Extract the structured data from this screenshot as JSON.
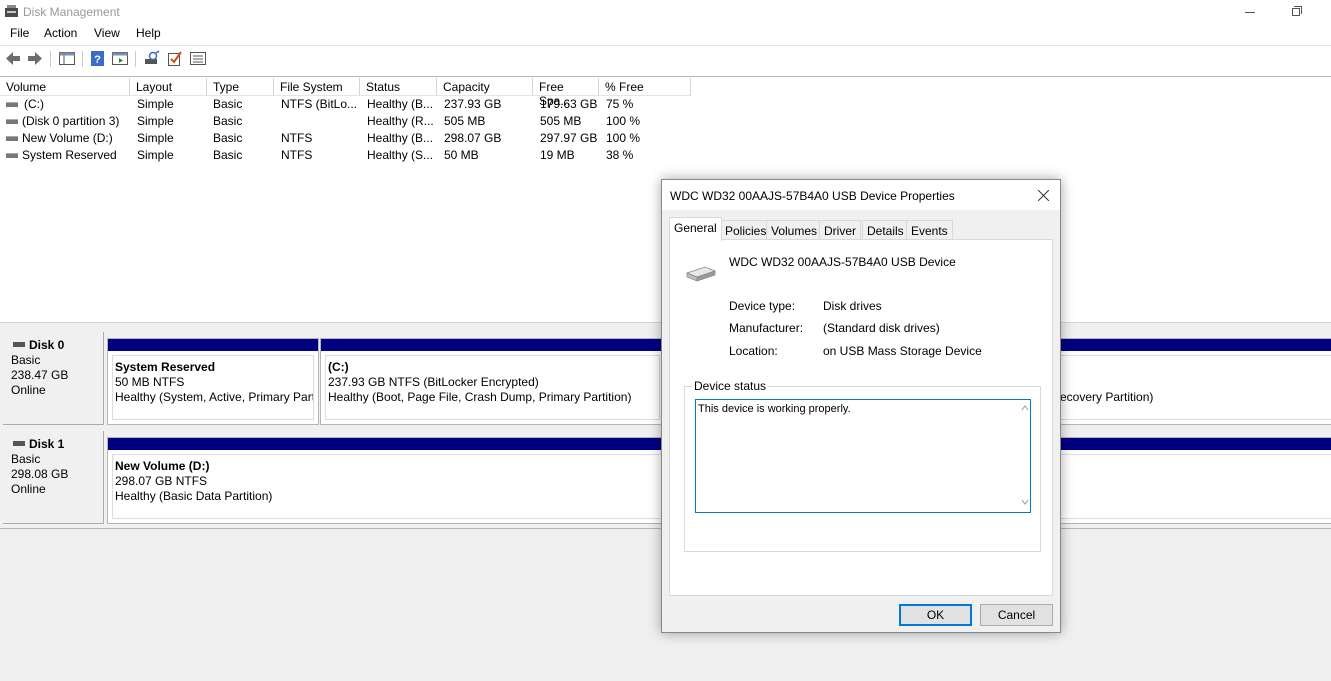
{
  "window": {
    "title": "Disk Management",
    "icon": "disk-management-icon"
  },
  "menu": [
    "File",
    "Action",
    "View",
    "Help"
  ],
  "toolbar": {
    "icons": [
      "back-arrow-icon",
      "forward-arrow-icon",
      "console-tree-icon",
      "help-icon",
      "properties-icon",
      "rescan-icon",
      "checklist-icon",
      "list-view-icon"
    ]
  },
  "volume_list": {
    "columns": [
      "Volume",
      "Layout",
      "Type",
      "File System",
      "Status",
      "Capacity",
      "Free Spa...",
      "% Free"
    ],
    "rows": [
      {
        "volume": "(C:)",
        "layout": "Simple",
        "type": "Basic",
        "fs": "NTFS (BitLo...",
        "status": "Healthy (B...",
        "capacity": "237.93 GB",
        "free": "179.63 GB",
        "pct": "75 %"
      },
      {
        "volume": "(Disk 0 partition 3)",
        "layout": "Simple",
        "type": "Basic",
        "fs": "",
        "status": "Healthy (R...",
        "capacity": "505 MB",
        "free": "505 MB",
        "pct": "100 %"
      },
      {
        "volume": "New Volume (D:)",
        "layout": "Simple",
        "type": "Basic",
        "fs": "NTFS",
        "status": "Healthy (B...",
        "capacity": "298.07 GB",
        "free": "297.97 GB",
        "pct": "100 %"
      },
      {
        "volume": "System Reserved",
        "layout": "Simple",
        "type": "Basic",
        "fs": "NTFS",
        "status": "Healthy (S...",
        "capacity": "50 MB",
        "free": "19 MB",
        "pct": "38 %"
      }
    ]
  },
  "disks": [
    {
      "name": "Disk 0",
      "type": "Basic",
      "size": "238.47 GB",
      "state": "Online",
      "partitions": [
        {
          "title": "System Reserved",
          "line1": "50 MB NTFS",
          "line2": "Healthy (System, Active, Primary Parti"
        },
        {
          "title": "(C:)",
          "line1": "237.93 GB NTFS (BitLocker Encrypted)",
          "line2": "Healthy (Boot, Page File, Crash Dump, Primary Partition)"
        },
        {
          "title": "",
          "line1": "",
          "line2": "ecovery Partition)"
        }
      ]
    },
    {
      "name": "Disk 1",
      "type": "Basic",
      "size": "298.08 GB",
      "state": "Online",
      "partitions": [
        {
          "title": "New Volume  (D:)",
          "line1": "298.07 GB NTFS",
          "line2": "Healthy (Basic Data Partition)"
        }
      ]
    }
  ],
  "dialog": {
    "title": "WDC WD32 00AAJS-57B4A0 USB Device Properties",
    "tabs": [
      "General",
      "Policies",
      "Volumes",
      "Driver",
      "Details",
      "Events"
    ],
    "device_name": "WDC WD32 00AAJS-57B4A0 USB Device",
    "properties": [
      {
        "label": "Device type:",
        "value": "Disk drives"
      },
      {
        "label": "Manufacturer:",
        "value": "(Standard disk drives)"
      },
      {
        "label": "Location:",
        "value": "on USB Mass Storage Device"
      }
    ],
    "status_label": "Device status",
    "status_text": "This device is working properly.",
    "ok_label": "OK",
    "cancel_label": "Cancel"
  }
}
